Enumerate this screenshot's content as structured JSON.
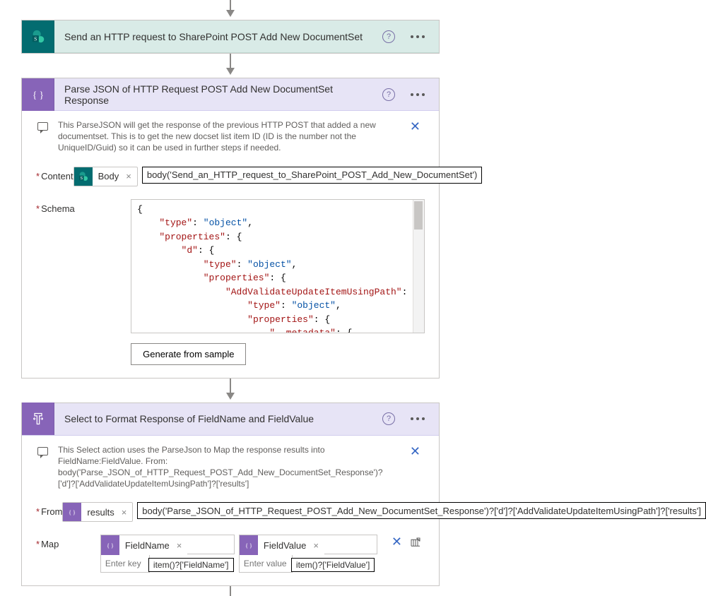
{
  "step1": {
    "title": "Send an HTTP request to SharePoint POST Add New DocumentSet"
  },
  "step2": {
    "title": "Parse JSON of HTTP Request POST Add New DocumentSet Response",
    "comment": "This ParseJSON will get the response of the previous HTTP POST that added a new documentset. This is to get the new docset list item ID (ID is the number not the UniqueID/Guid) so it can be used in further steps if needed.",
    "label_content": "Content",
    "label_schema": "Schema",
    "token_body": "Body",
    "formula_body": "body('Send_an_HTTP_request_to_SharePoint_POST_Add_New_DocumentSet')",
    "schema_line_open": "{",
    "schema_k_type": "\"type\"",
    "schema_v_object": "\"object\"",
    "schema_k_properties": "\"properties\"",
    "schema_k_d": "\"d\"",
    "schema_k_addvalidate": "\"AddValidateUpdateItemUsingPath\"",
    "schema_k_metadata": "\"__metadata\"",
    "btn_generate": "Generate from sample"
  },
  "step3": {
    "title": "Select to Format Response of FieldName and FieldValue",
    "comment": "This Select action uses the ParseJson to Map the response results into FieldName:FieldValue. From: body('Parse_JSON_of_HTTP_Request_POST_Add_New_DocumentSet_Response')?['d']?['AddValidateUpdateItemUsingPath']?['results']",
    "label_from": "From",
    "label_map": "Map",
    "token_results": "results",
    "formula_from": "body('Parse_JSON_of_HTTP_Request_POST_Add_New_DocumentSet_Response')?['d']?['AddValidateUpdateItemUsingPath']?['results']",
    "token_fieldname": "FieldName",
    "token_fieldvalue": "FieldValue",
    "ph_enterkey": "Enter key",
    "ph_entervalue": "Enter value",
    "formula_fname": "item()?['FieldName']",
    "formula_fvalue": "item()?['FieldValue']"
  }
}
